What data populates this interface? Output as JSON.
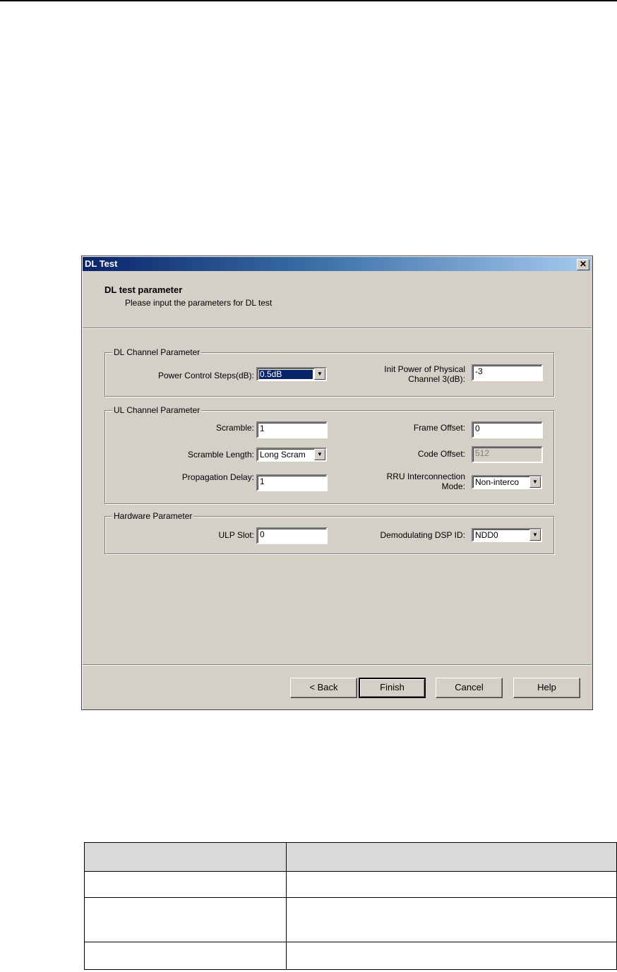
{
  "dialog": {
    "title": "DL Test",
    "close_glyph": "✕",
    "header_title": "DL test parameter",
    "header_subtitle": "Please input the parameters for DL test"
  },
  "dl_channel": {
    "legend": "DL Channel Parameter",
    "power_control_steps_label": "Power Control Steps(dB):",
    "power_control_steps_value": "0.5dB",
    "init_power_label_line1": "Init Power of Physical",
    "init_power_label_line2": "Channel 3(dB):",
    "init_power_value": "-3"
  },
  "ul_channel": {
    "legend": "UL Channel Parameter",
    "scramble_label": "Scramble:",
    "scramble_value": "1",
    "frame_offset_label": "Frame Offset:",
    "frame_offset_value": "0",
    "scramble_length_label": "Scramble Length:",
    "scramble_length_value": "Long Scram",
    "code_offset_label": "Code Offset:",
    "code_offset_value": "512",
    "propagation_delay_label": "Propagation Delay:",
    "propagation_delay_value": "1",
    "rru_mode_label_line1": "RRU Interconnection",
    "rru_mode_label_line2": "Mode:",
    "rru_mode_value": "Non-interco"
  },
  "hardware": {
    "legend": "Hardware Parameter",
    "ulp_slot_label": "ULP Slot:",
    "ulp_slot_value": "0",
    "dsp_id_label": "Demodulating DSP ID:",
    "dsp_id_value": "NDD0"
  },
  "buttons": {
    "back": "< Back",
    "finish": "Finish",
    "cancel": "Cancel",
    "help": "Help"
  },
  "icons": {
    "dropdown_arrow": "▼"
  }
}
